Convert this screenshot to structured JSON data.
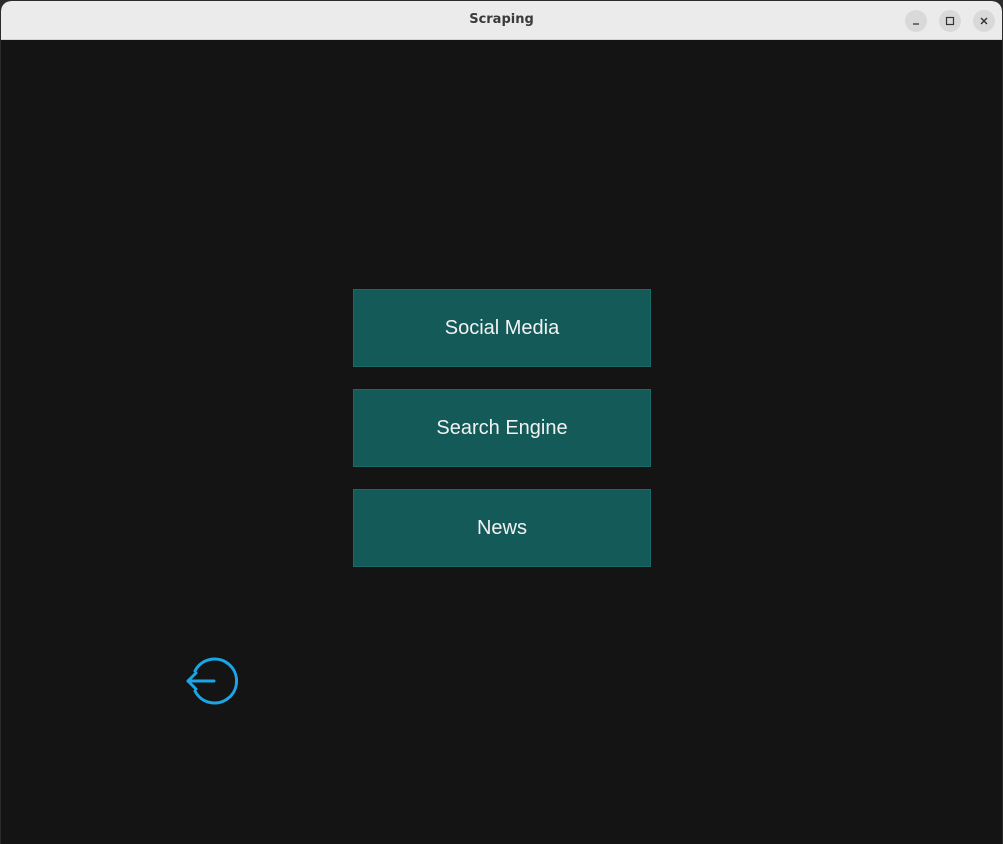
{
  "window": {
    "title": "Scraping"
  },
  "menu": {
    "buttons": [
      {
        "label": "Social Media"
      },
      {
        "label": "Search Engine"
      },
      {
        "label": "News"
      }
    ]
  },
  "back": {
    "icon": "back-arrow-circle-icon",
    "color": "#1aa6e6"
  },
  "colors": {
    "background": "#141414",
    "button": "#145a59",
    "titlebar": "#ebebeb"
  }
}
